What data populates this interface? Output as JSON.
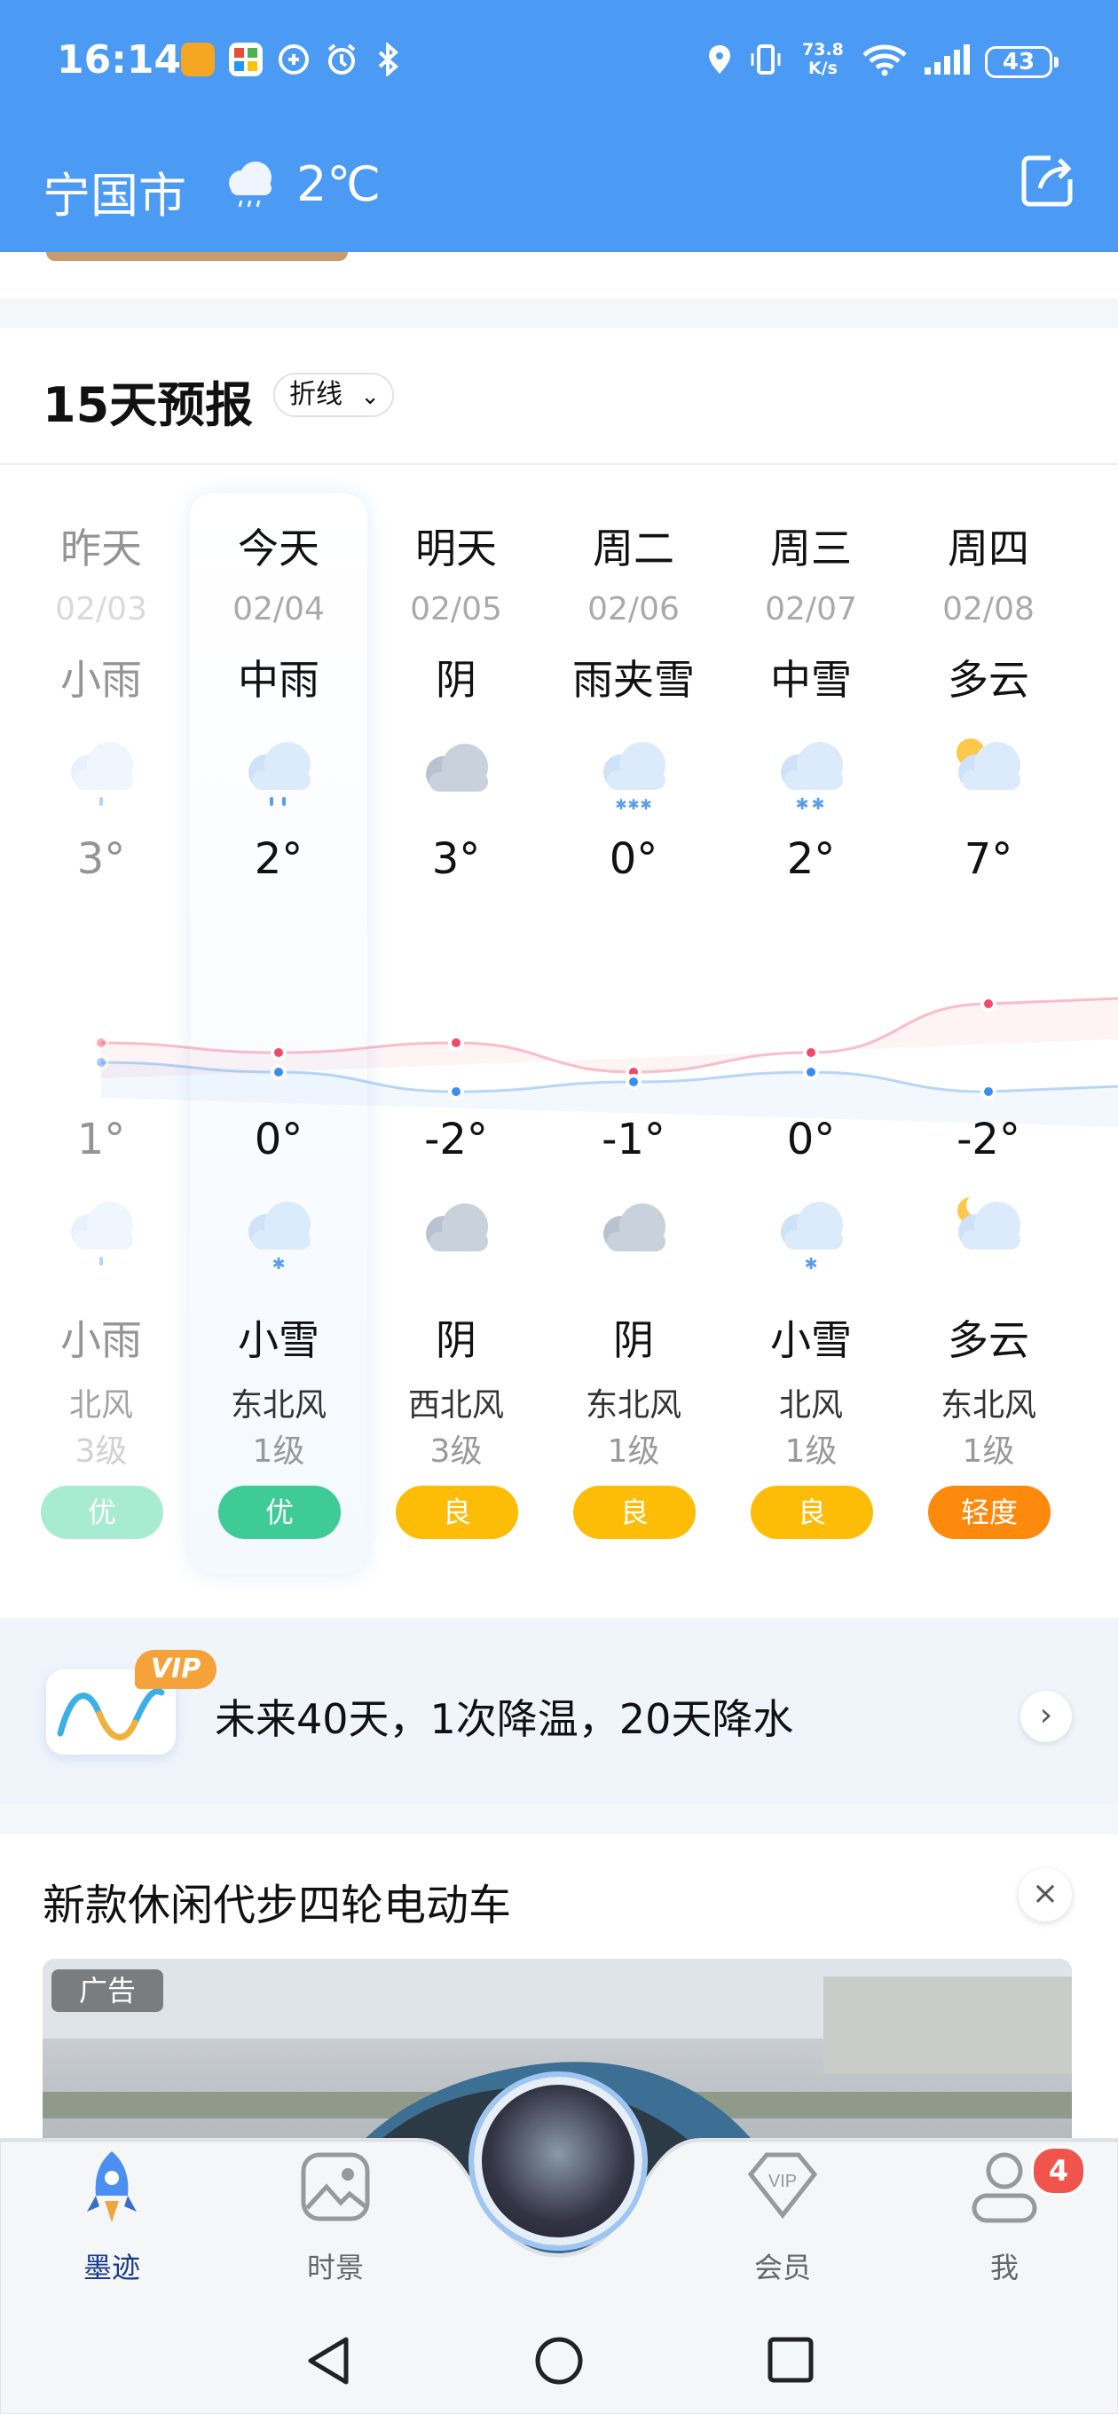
{
  "status_bar": {
    "time": "16:14",
    "net_speed_value": "73.8",
    "net_speed_unit": "K/s",
    "battery": "43"
  },
  "header": {
    "city": "宁国市",
    "current_temp": "2℃"
  },
  "forecast": {
    "title": "15天预报",
    "mode": "折线",
    "days": [
      {
        "day": "昨天",
        "date": "02/03",
        "weather_day": "小雨",
        "icon_day": "light-rain-icon",
        "high": "3°",
        "high_value": 3,
        "low": "1°",
        "low_value": 1,
        "icon_night": "light-rain-icon",
        "weather_night": "小雨",
        "wind_dir": "北风",
        "wind_level": "3级",
        "aqi": "优",
        "aqi_color": "#3dd29e",
        "past": true
      },
      {
        "day": "今天",
        "date": "02/04",
        "weather_day": "中雨",
        "icon_day": "moderate-rain-icon",
        "high": "2°",
        "high_value": 2,
        "low": "0°",
        "low_value": 0,
        "icon_night": "light-snow-icon",
        "weather_night": "小雪",
        "wind_dir": "东北风",
        "wind_level": "1级",
        "aqi": "优",
        "aqi_color": "#3ecb96",
        "past": false
      },
      {
        "day": "明天",
        "date": "02/05",
        "weather_day": "阴",
        "icon_day": "overcast-icon",
        "high": "3°",
        "high_value": 3,
        "low": "-2°",
        "low_value": -2,
        "icon_night": "overcast-icon",
        "weather_night": "阴",
        "wind_dir": "西北风",
        "wind_level": "3级",
        "aqi": "良",
        "aqi_color": "#fdbd06",
        "past": false
      },
      {
        "day": "周二",
        "date": "02/06",
        "weather_day": "雨夹雪",
        "icon_day": "sleet-icon",
        "high": "0°",
        "high_value": 0,
        "low": "-1°",
        "low_value": -1,
        "icon_night": "overcast-icon",
        "weather_night": "阴",
        "wind_dir": "东北风",
        "wind_level": "1级",
        "aqi": "良",
        "aqi_color": "#fdbd06",
        "past": false
      },
      {
        "day": "周三",
        "date": "02/07",
        "weather_day": "中雪",
        "icon_day": "moderate-snow-icon",
        "high": "2°",
        "high_value": 2,
        "low": "0°",
        "low_value": 0,
        "icon_night": "light-snow-icon",
        "weather_night": "小雪",
        "wind_dir": "北风",
        "wind_level": "1级",
        "aqi": "良",
        "aqi_color": "#fdbd06",
        "past": false
      },
      {
        "day": "周四",
        "date": "02/08",
        "weather_day": "多云",
        "icon_day": "partly-cloudy-day-icon",
        "high": "7°",
        "high_value": 7,
        "low": "-2°",
        "low_value": -2,
        "icon_night": "partly-cloudy-night-icon",
        "weather_night": "多云",
        "wind_dir": "东北风",
        "wind_level": "1级",
        "aqi": "轻度",
        "aqi_color": "#fd8a0c",
        "past": false
      }
    ]
  },
  "chart_data": {
    "type": "line",
    "x": [
      "昨天",
      "今天",
      "明天",
      "周二",
      "周三",
      "周四"
    ],
    "series": [
      {
        "values": [
          3,
          2,
          3,
          0,
          2,
          7
        ],
        "color": "#f04a6a"
      },
      {
        "values": [
          1,
          0,
          -2,
          -1,
          0,
          -2
        ],
        "color": "#3a8ef0"
      }
    ]
  },
  "vip_banner": {
    "badge": "VIP",
    "text": "未来40天，1次降温，20天降水"
  },
  "ad": {
    "title": "新款休闲代步四轮电动车",
    "label": "广告"
  },
  "bottom_nav": {
    "items": [
      {
        "label": "墨迹",
        "icon": "rocket-icon",
        "active": true
      },
      {
        "label": "时景",
        "icon": "gallery-icon",
        "active": false
      },
      {
        "label": "会员",
        "icon": "vip-diamond-icon",
        "active": false
      },
      {
        "label": "我",
        "icon": "profile-icon",
        "active": false
      }
    ],
    "profile_badge": "4"
  },
  "colors": {
    "header_bg": "#4b9af3",
    "accent": "#4b9af3"
  }
}
